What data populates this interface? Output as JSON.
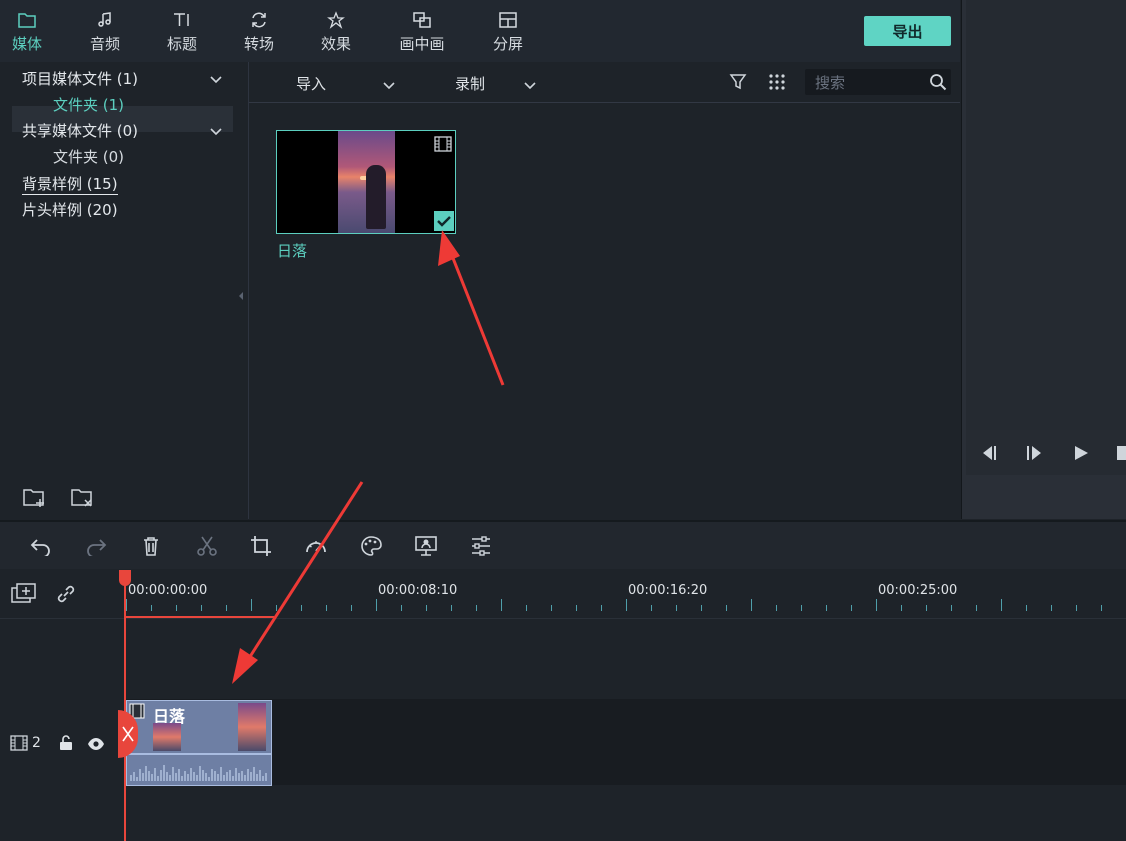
{
  "tabs": [
    {
      "label": "媒体",
      "icon": "folder-icon",
      "active": true
    },
    {
      "label": "音频",
      "icon": "music-note-icon"
    },
    {
      "label": "标题",
      "icon": "text-title-icon"
    },
    {
      "label": "转场",
      "icon": "transition-icon"
    },
    {
      "label": "效果",
      "icon": "effects-star-icon"
    },
    {
      "label": "画中画",
      "icon": "picture-in-picture-icon"
    },
    {
      "label": "分屏",
      "icon": "split-screen-icon"
    }
  ],
  "export_label": "导出",
  "sidebar": {
    "items": [
      {
        "label": "项目媒体文件 (1)",
        "expandable": true
      },
      {
        "label": "文件夹 (1)",
        "sub": true,
        "selected": true
      },
      {
        "label": "共享媒体文件 (0)",
        "expandable": true
      },
      {
        "label": "文件夹 (0)",
        "sub": true
      },
      {
        "label": "背景样例 (15)",
        "highlighted": true
      },
      {
        "label": "片头样例 (20)"
      }
    ]
  },
  "media_toolbar": {
    "import_label": "导入",
    "record_label": "录制",
    "search_placeholder": "搜索"
  },
  "media": {
    "items": [
      {
        "name": "日落",
        "checked": true
      }
    ]
  },
  "timeline": {
    "timecodes": [
      "00:00:00:00",
      "00:00:08:10",
      "00:00:16:20",
      "00:00:25:00"
    ],
    "track_number": "2",
    "clip_name": "日落"
  },
  "colors": {
    "accent": "#5ccfbf",
    "playhead": "#e8463c",
    "annotation_arrow": "#ee3a36",
    "clip": "#6e7fa4"
  }
}
